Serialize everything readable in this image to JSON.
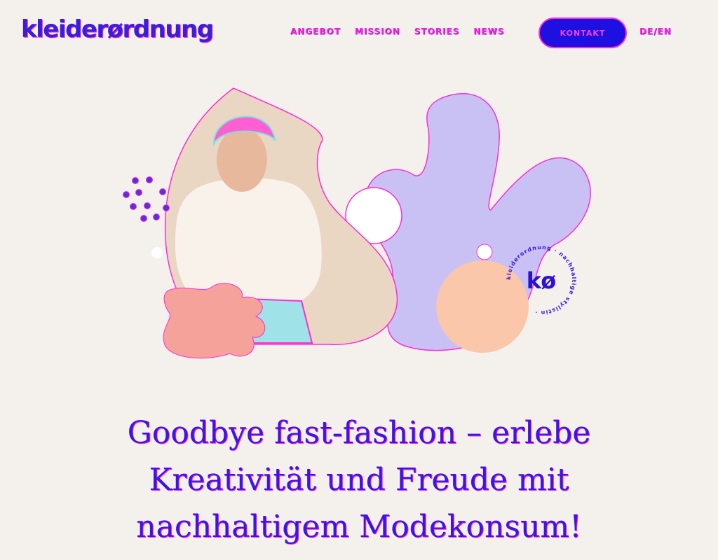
{
  "brand": {
    "logo_text": "kleiderørdnung"
  },
  "nav": {
    "items": [
      "ANGEBOT",
      "MISSION",
      "STORIES",
      "NEWS"
    ],
    "contact_label": "KONTAKT",
    "language_label": "DE/EN"
  },
  "hero": {
    "badge_monogram": "kø",
    "badge_ring_text": "kleiderordnung · nachhaltige stylistin · "
  },
  "headline": {
    "lines": [
      "Goodbye fast-fashion – erlebe",
      "Kreativität und Freude mit",
      "nachhaltigem Modekonsum!"
    ]
  },
  "colors": {
    "accent": "#3a16e6",
    "highlight": "#ff1fd0",
    "background": "#f4f1ec",
    "lavender": "#c9c1f4",
    "salmon": "#f4a29a",
    "peach": "#fbc7aa"
  }
}
